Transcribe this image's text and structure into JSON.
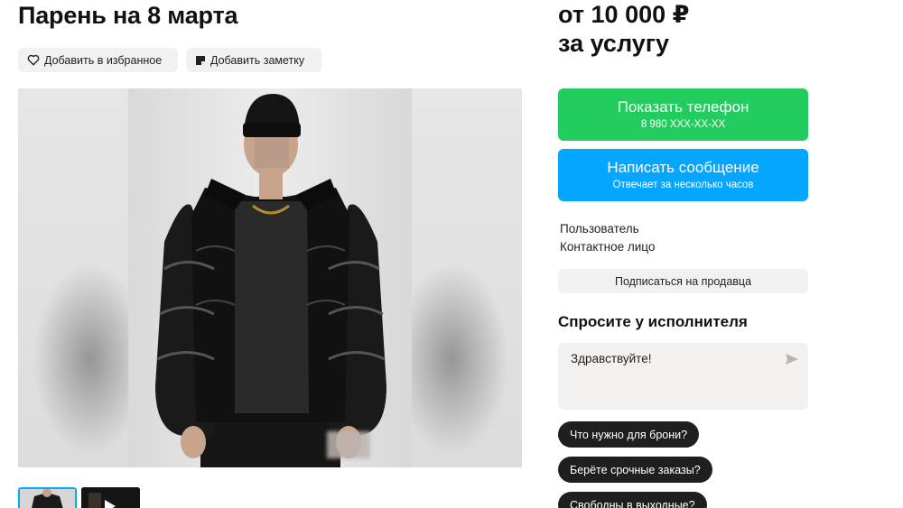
{
  "listing": {
    "title": "Парень на 8 марта",
    "actions": {
      "favorite_label": "Добавить в избранное",
      "note_label": "Добавить заметку"
    }
  },
  "price": {
    "line1": "от 10 000 ₽",
    "line2": "за услугу"
  },
  "contact": {
    "phone_button": "Показать телефон",
    "phone_masked": "8 980 XXX-XX-XX",
    "message_button": "Написать сообщение",
    "message_sub": "Отвечает за несколько часов"
  },
  "seller": {
    "name": "Пользователь",
    "role": "Контактное лицо",
    "subscribe_label": "Подписаться на продавца"
  },
  "ask": {
    "title": "Спросите у исполнителя",
    "message_value": "Здравствуйте!",
    "quick_questions": [
      "Что нужно для брони?",
      "Берёте срочные заказы?",
      "Свободны в выходные?"
    ]
  },
  "colors": {
    "phone_button": "#22cc5e",
    "message_button": "#05a6ff",
    "chip_bg": "#f2f1ef",
    "thumb_selected_border": "#00aaff"
  },
  "icons": {
    "favorite": "heart-icon",
    "note": "note-icon",
    "send": "send-icon"
  }
}
